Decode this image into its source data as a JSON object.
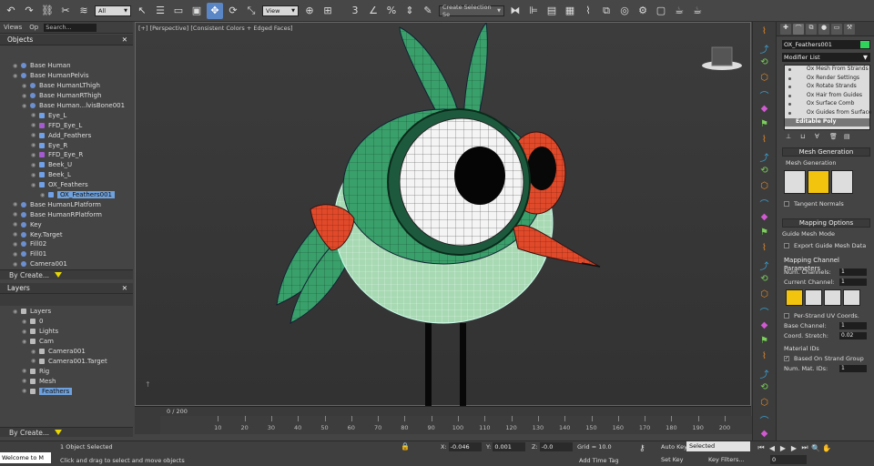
{
  "toolbar": {
    "filter": "All",
    "refcoord": "View",
    "selset": "Create Selection Se"
  },
  "tabs": {
    "views": "Views",
    "op": "Op",
    "search": "Search..."
  },
  "objects": {
    "title": "Objects",
    "items": [
      {
        "label": "Base Human",
        "indent": 8,
        "ic": "blue"
      },
      {
        "label": "Base HumanPelvis",
        "indent": 8,
        "ic": "blue"
      },
      {
        "label": "Base HumanLThigh",
        "indent": 18,
        "ic": "blue"
      },
      {
        "label": "Base HumanRThigh",
        "indent": 18,
        "ic": "blue"
      },
      {
        "label": "Base Human...lvisBone001",
        "indent": 18,
        "ic": "blue"
      },
      {
        "label": "Eye_L",
        "indent": 28,
        "ic": "geo"
      },
      {
        "label": "FFD_Eye_L",
        "indent": 28,
        "ic": "purple"
      },
      {
        "label": "Add_Feathers",
        "indent": 28,
        "ic": "geo"
      },
      {
        "label": "Eye_R",
        "indent": 28,
        "ic": "geo"
      },
      {
        "label": "FFD_Eye_R",
        "indent": 28,
        "ic": "purple"
      },
      {
        "label": "Beek_U",
        "indent": 28,
        "ic": "geo"
      },
      {
        "label": "Beek_L",
        "indent": 28,
        "ic": "geo"
      },
      {
        "label": "OX_Feathers",
        "indent": 28,
        "ic": "geo"
      },
      {
        "label": "OX_Feathers001",
        "indent": 38,
        "ic": "geo",
        "selected": true
      },
      {
        "label": "Base HumanLPlatform",
        "indent": 8,
        "ic": "blue"
      },
      {
        "label": "Base HumanRPlatform",
        "indent": 8,
        "ic": "blue"
      },
      {
        "label": "Key",
        "indent": 8,
        "ic": "blue"
      },
      {
        "label": "Key.Target",
        "indent": 8,
        "ic": "blue"
      },
      {
        "label": "Fill02",
        "indent": 8,
        "ic": "blue"
      },
      {
        "label": "Fill01",
        "indent": 8,
        "ic": "blue"
      },
      {
        "label": "Camera001",
        "indent": 8,
        "ic": "blue"
      }
    ]
  },
  "by_create": "By Create...",
  "layers": {
    "title": "Layers",
    "items": [
      {
        "label": "Layers",
        "indent": 8
      },
      {
        "label": "0",
        "indent": 18
      },
      {
        "label": "Lights",
        "indent": 18
      },
      {
        "label": "Cam",
        "indent": 18
      },
      {
        "label": "Camera001",
        "indent": 28
      },
      {
        "label": "Camera001.Target",
        "indent": 28
      },
      {
        "label": "Rig",
        "indent": 18
      },
      {
        "label": "Mesh",
        "indent": 18
      },
      {
        "label": "Feathers",
        "indent": 18,
        "selected": true
      }
    ]
  },
  "viewport": {
    "label": "[+] [Perspective] [Consistent Colors + Edged Faces]"
  },
  "timeline": {
    "frame": "0 / 200",
    "ticks": [
      "10",
      "20",
      "30",
      "40",
      "50",
      "60",
      "70",
      "80",
      "90",
      "100",
      "110",
      "120",
      "130",
      "140",
      "150",
      "160",
      "170",
      "180",
      "190",
      "200"
    ]
  },
  "command": {
    "name": "OX_Feathers001",
    "modlist": "Modifier List",
    "stack": [
      "Ox Mesh From Strands",
      "Ox Render Settings",
      "Ox Rotate Strands",
      "Ox Hair from Guides",
      "Ox Surface Comb",
      "Ox Guides from Surface",
      "Editable Poly"
    ],
    "meshgen_title": "Mesh Generation",
    "meshgen_label": "Mesh Generation",
    "tangent": "Tangent Normals",
    "mapping_title": "Mapping Options",
    "guide_mesh_mode": "Guide Mesh Mode",
    "export_guide": "Export Guide Mesh Data",
    "mcp_title": "Mapping Channel Parameters",
    "num_channels_label": "Num. Channels:",
    "num_channels": "1",
    "current_channel_label": "Current Channel:",
    "current_channel": "1",
    "per_strand": "Per-Strand UV Coords.",
    "base_channel_label": "Base Channel:",
    "base_channel": "1",
    "coord_stretch_label": "Coord. Stretch:",
    "coord_stretch": "0.02",
    "material_ids": "Material IDs",
    "based_on_strand": "Based On Strand Group",
    "num_mat_ids_label": "Num. Mat. IDs:",
    "num_mat_ids": "1"
  },
  "status": {
    "maxscript": "Welcome to M",
    "objects_selected": "1 Object Selected",
    "hint": "Click and drag to select and move objects",
    "x_label": "X:",
    "x": "-0.046",
    "y_label": "Y:",
    "y": "0.001",
    "z_label": "Z:",
    "z": "-0.0",
    "grid": "Grid = 10.0",
    "add_time_tag": "Add Time Tag",
    "auto_key": "Auto Key",
    "set_key": "Set Key",
    "selected": "Selected",
    "key_filters": "Key Filters...",
    "frame": "0"
  }
}
